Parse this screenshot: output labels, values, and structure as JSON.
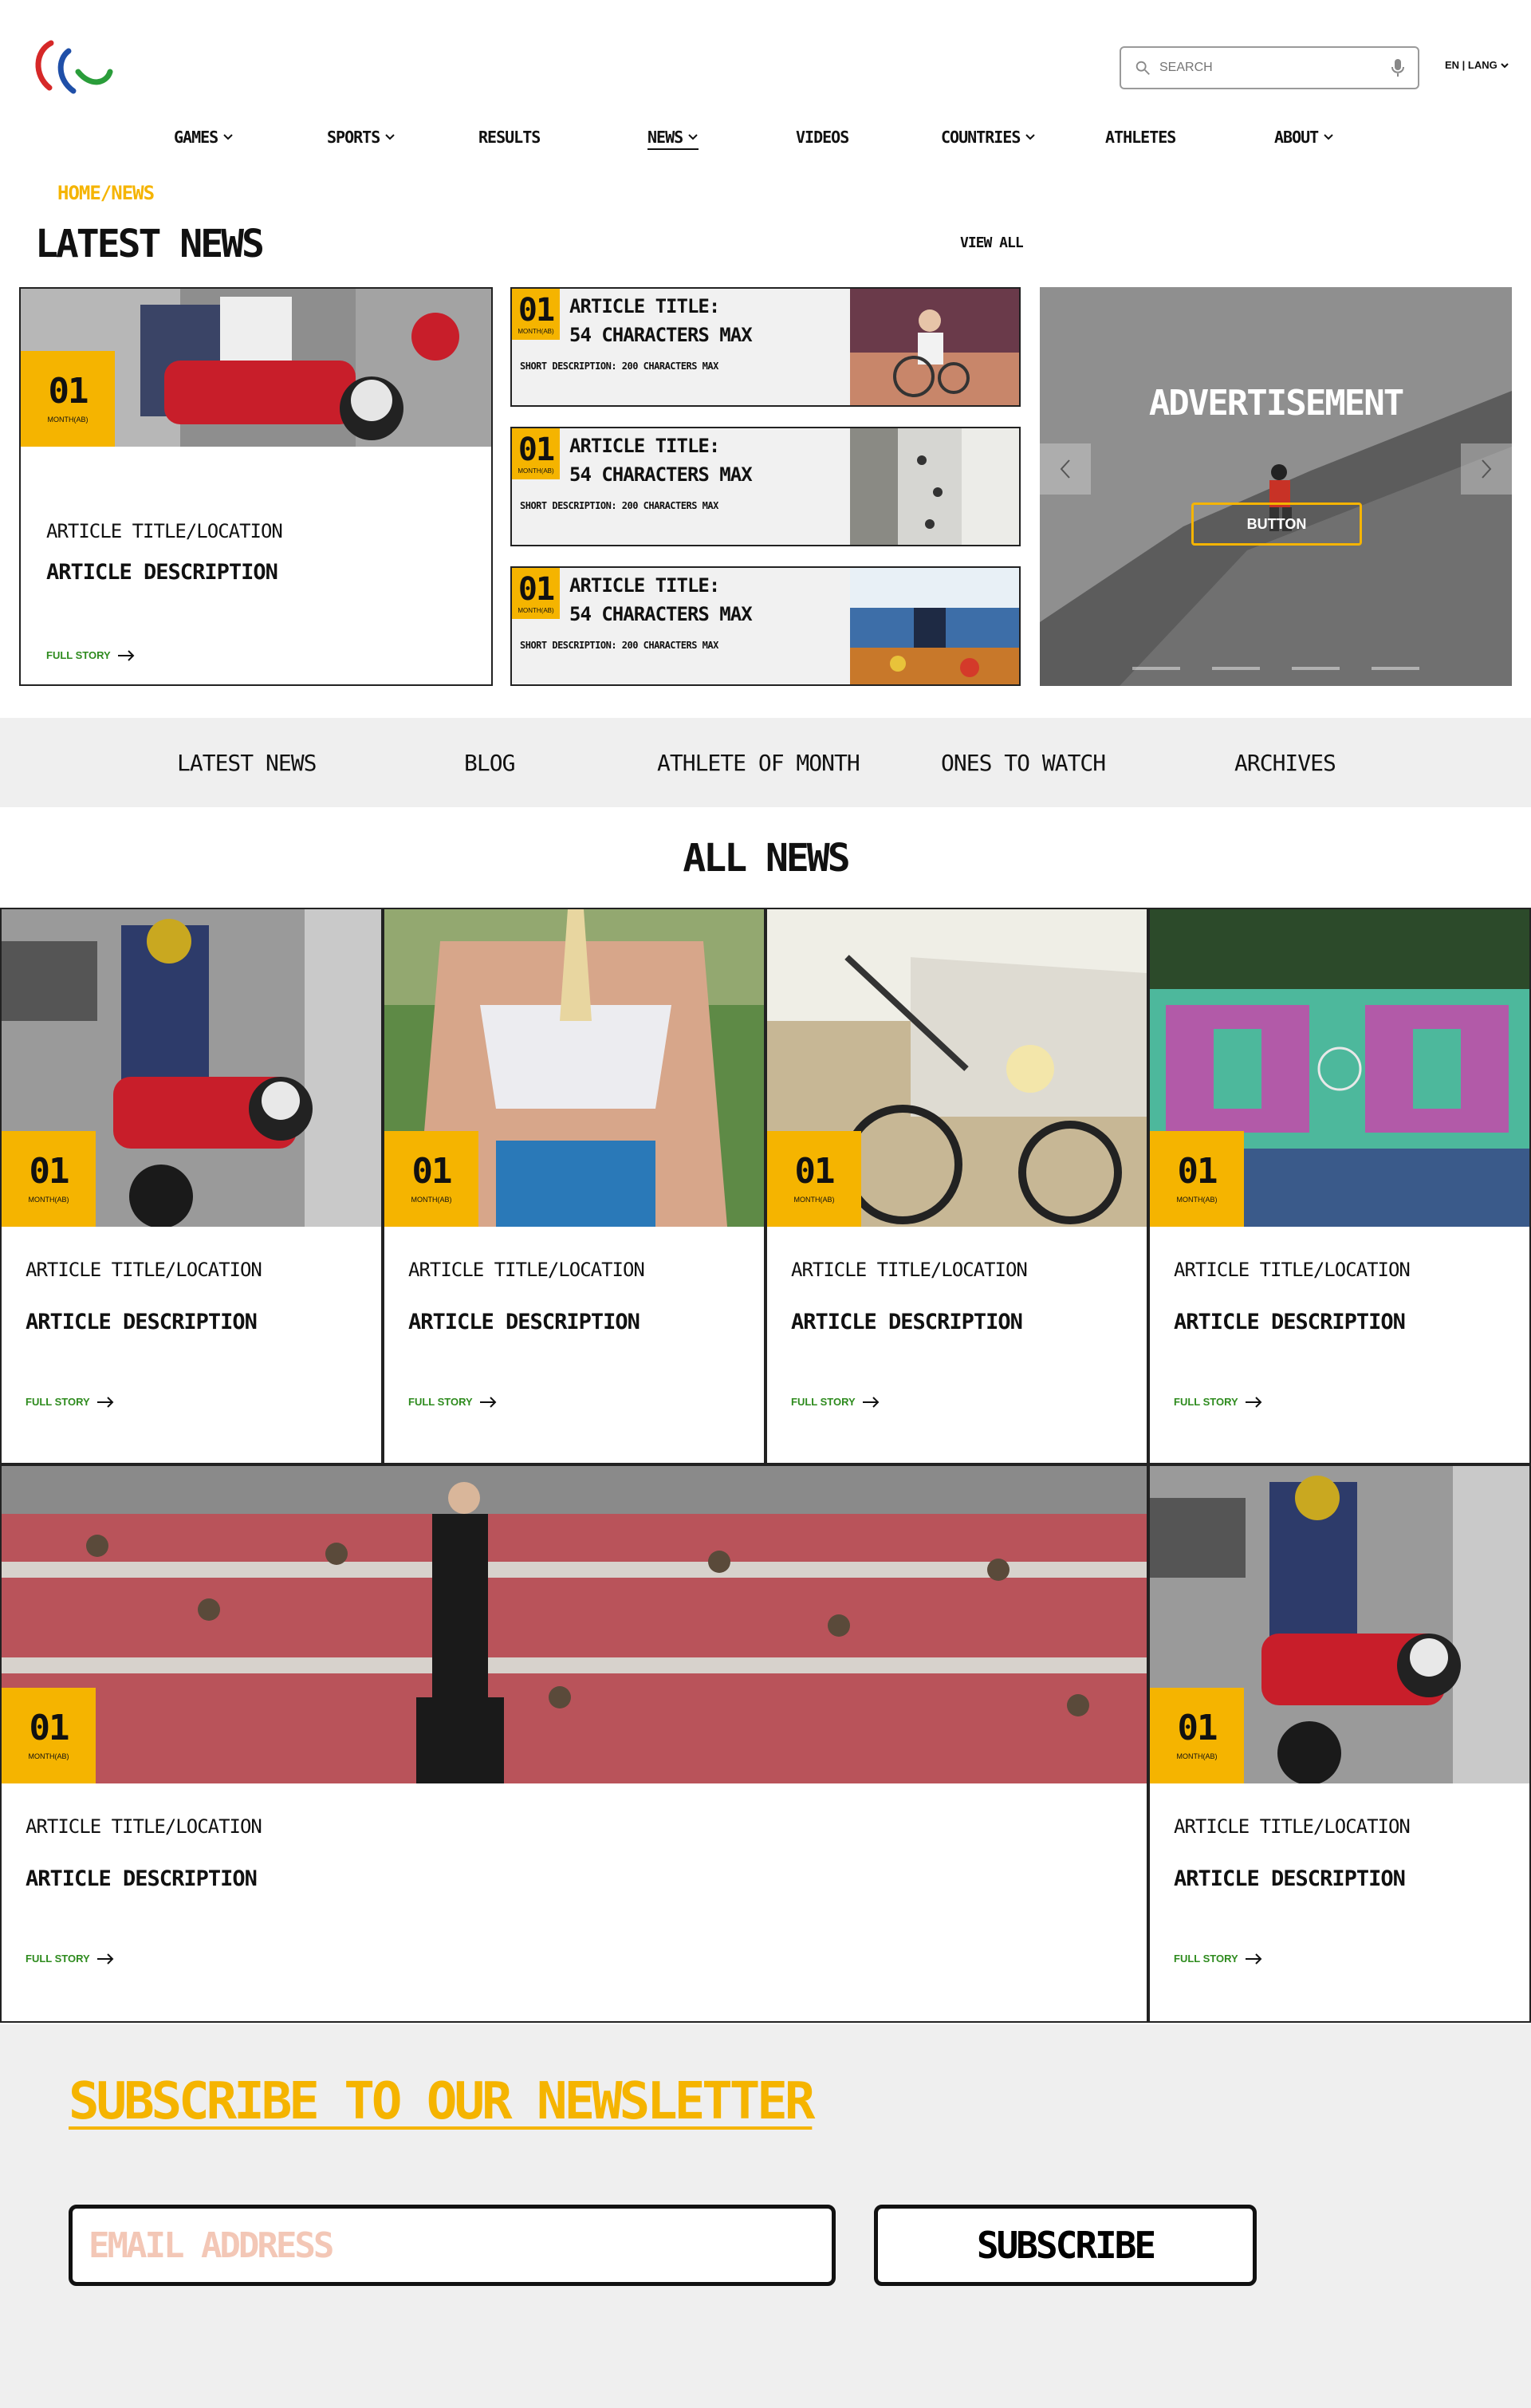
{
  "header": {
    "search_placeholder": "SEARCH",
    "lang": "EN | LANG"
  },
  "nav": {
    "items": [
      {
        "label": "GAMES",
        "dropdown": true
      },
      {
        "label": "SPORTS",
        "dropdown": true
      },
      {
        "label": "RESULTS",
        "dropdown": false
      },
      {
        "label": "NEWS",
        "dropdown": true,
        "active": true
      },
      {
        "label": "VIDEOS",
        "dropdown": false
      },
      {
        "label": "COUNTRIES",
        "dropdown": true
      },
      {
        "label": "ATHLETES",
        "dropdown": false
      },
      {
        "label": "ABOUT",
        "dropdown": true
      }
    ]
  },
  "breadcrumb": "HOME/NEWS",
  "latest": {
    "title": "LATEST NEWS",
    "view_all": "VIEW ALL",
    "featured": {
      "day": "01",
      "month": "MONTH(AB)",
      "location": "ARTICLE TITLE/LOCATION",
      "description": "ARTICLE DESCRIPTION",
      "full_story": "FULL STORY"
    },
    "small": [
      {
        "day": "01",
        "month": "MONTH(AB)",
        "title_line1": "ARTICLE TITLE:",
        "title_line2": "54 CHARACTERS MAX",
        "description": "SHORT DESCRIPTION: 200 CHARACTERS MAX"
      },
      {
        "day": "01",
        "month": "MONTH(AB)",
        "title_line1": "ARTICLE TITLE:",
        "title_line2": "54 CHARACTERS MAX",
        "description": "SHORT DESCRIPTION: 200 CHARACTERS MAX"
      },
      {
        "day": "01",
        "month": "MONTH(AB)",
        "title_line1": "ARTICLE TITLE:",
        "title_line2": "54 CHARACTERS MAX",
        "description": "SHORT DESCRIPTION: 200 CHARACTERS MAX"
      }
    ]
  },
  "ad": {
    "title": "ADVERTISEMENT",
    "button": "BUTTON"
  },
  "tabs": [
    "LATEST NEWS",
    "BLOG",
    "ATHLETE OF MONTH",
    "ONES TO WATCH",
    "ARCHIVES"
  ],
  "all_news": {
    "title": "ALL NEWS",
    "cards": [
      {
        "day": "01",
        "month": "MONTH(AB)",
        "location": "ARTICLE TITLE/LOCATION",
        "description": "ARTICLE DESCRIPTION",
        "full_story": "FULL STORY"
      },
      {
        "day": "01",
        "month": "MONTH(AB)",
        "location": "ARTICLE TITLE/LOCATION",
        "description": "ARTICLE DESCRIPTION",
        "full_story": "FULL STORY"
      },
      {
        "day": "01",
        "month": "MONTH(AB)",
        "location": "ARTICLE TITLE/LOCATION",
        "description": "ARTICLE DESCRIPTION",
        "full_story": "FULL STORY"
      },
      {
        "day": "01",
        "month": "MONTH(AB)",
        "location": "ARTICLE TITLE/LOCATION",
        "description": "ARTICLE DESCRIPTION",
        "full_story": "FULL STORY"
      },
      {
        "day": "01",
        "month": "MONTH(AB)",
        "location": "ARTICLE TITLE/LOCATION",
        "description": "ARTICLE DESCRIPTION",
        "full_story": "FULL STORY"
      },
      {
        "day": "01",
        "month": "MONTH(AB)",
        "location": "ARTICLE TITLE/LOCATION",
        "description": "ARTICLE DESCRIPTION",
        "full_story": "FULL STORY"
      }
    ]
  },
  "newsletter": {
    "title": "SUBSCRIBE TO OUR NEWSLETTER",
    "email_placeholder": "EMAIL ADDRESS",
    "button": "SUBSCRIBE"
  },
  "colors": {
    "accent": "#f5b400",
    "full_story": "#2e8b1e",
    "band": "#efefef"
  }
}
